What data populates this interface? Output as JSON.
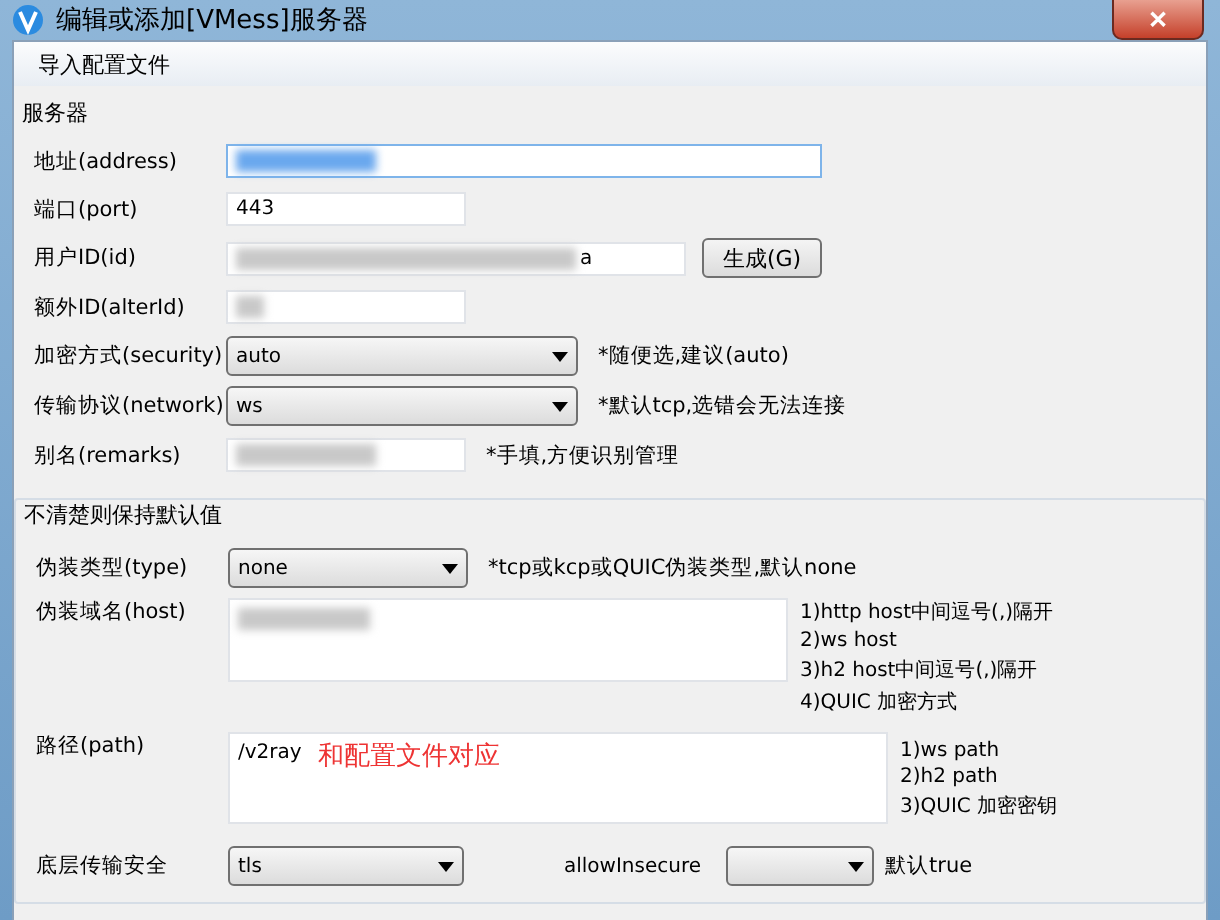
{
  "window": {
    "title": "编辑或添加[VMess]服务器",
    "close": "✕"
  },
  "menu": [
    {
      "label": "导入配置文件"
    }
  ],
  "server_group": {
    "title": "服务器",
    "rows": [
      {
        "kind": "wide_input",
        "label": "地址(address)",
        "redacted": true,
        "focused": true
      },
      {
        "kind": "input",
        "label": "端口(port)",
        "value": "443",
        "redacted": false,
        "focused": false
      },
      {
        "kind": "input_button",
        "label": "用户ID(id)",
        "value": "a",
        "redacted": true,
        "focused": false,
        "button": "生成(G)"
      },
      {
        "kind": "input",
        "label": "额外ID(alterId)",
        "redacted": true,
        "focused": false
      },
      {
        "kind": "select",
        "label": "加密方式(security)",
        "value": "auto",
        "hint": "*随便选,建议(auto)"
      },
      {
        "kind": "select",
        "label": "传输协议(network)",
        "value": "ws",
        "hint": "*默认tcp,选错会无法连接"
      },
      {
        "kind": "input",
        "label": "别名(remarks)",
        "redacted": true,
        "focused": false,
        "hint": "*手填,方便识别管理"
      }
    ]
  },
  "advanced_group": {
    "title": "不清楚则保持默认值",
    "type_row": {
      "label": "伪装类型(type)",
      "value": "none",
      "hint": "*tcp或kcp或QUIC伪装类型,默认none"
    },
    "host_row": {
      "label": "伪装域名(host)",
      "redacted": true,
      "hints": [
        "1)http host中间逗号(,)隔开",
        "2)ws host",
        "3)h2 host中间逗号(,)隔开",
        "4)QUIC 加密方式"
      ]
    },
    "path_row": {
      "label": "路径(path)",
      "value": "/v2ray",
      "annotation": "和配置文件对应",
      "hints": [
        "1)ws path",
        "2)h2 path",
        "3)QUIC 加密密钥"
      ]
    },
    "security_row": {
      "label": "底层传输安全",
      "value": "tls",
      "insecure_label": "allowInsecure",
      "hint": "默认true"
    }
  }
}
